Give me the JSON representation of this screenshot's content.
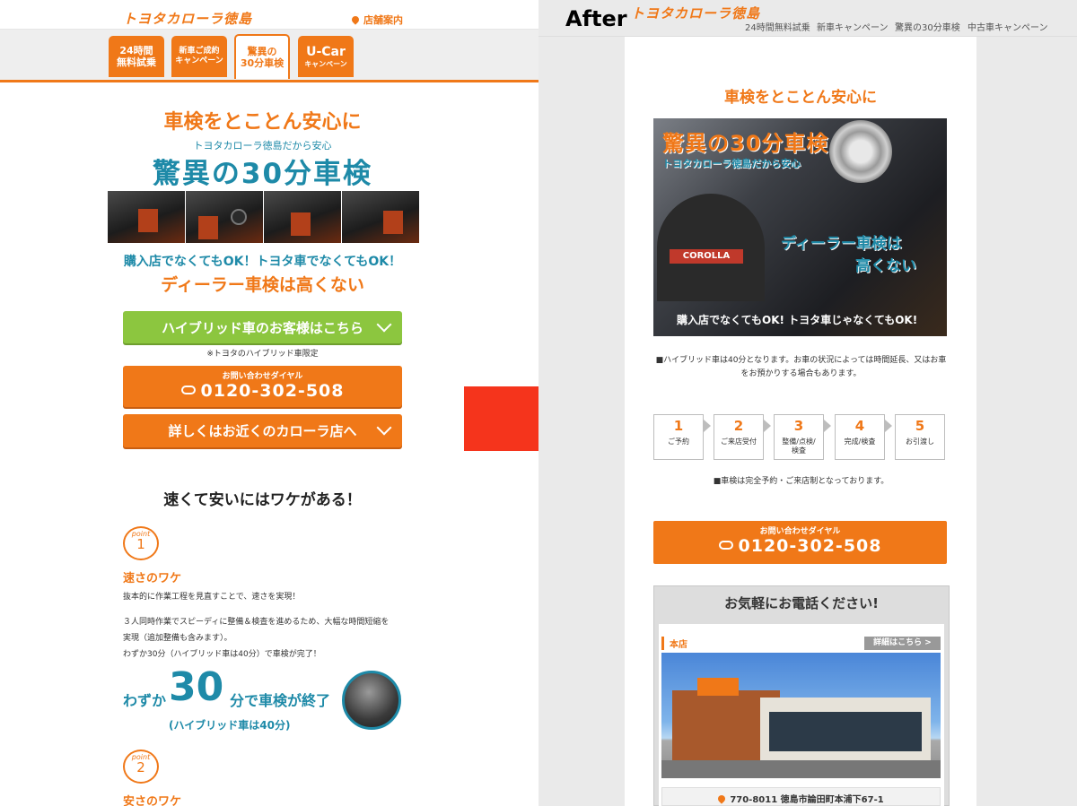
{
  "before": {
    "logo": "トヨタカローラ徳島",
    "store_link": "店舗案内",
    "tabs": [
      {
        "line1": "24時間",
        "line2": "無料試乗"
      },
      {
        "line1": "新車ご成約",
        "line2": "キャンペーン"
      },
      {
        "line1": "驚異の",
        "line2": "30分車検"
      },
      {
        "line1": "U-Car",
        "line2": "キャンペーン"
      }
    ],
    "headline": "車検をとことん安心に",
    "subhead": "トヨタカローラ徳島だから安心",
    "title": "驚異の30分車検",
    "ok_line": "購入店でなくてもOK！トヨタ車でなくてもOK！",
    "dealer_line": "ディーラー車検は高くない",
    "hybrid_button": "ハイブリッド車のお客様はこちら",
    "hybrid_note": "※トヨタのハイブリッド車限定",
    "dial_label": "お問い合わせダイヤル",
    "dial_number": "0120-302-508",
    "nearby_button": "詳しくはお近くのカローラ店へ",
    "why_heading": "速くて安いにはワケがある！",
    "point_word": "point",
    "point1_number": "1",
    "point1_title": "速さのワケ",
    "point1_text1": "抜本的に作業工程を見直すことで、速さを実現！",
    "point1_text2": "３人同時作業でスピーディに整備＆検査を進めるため、大幅な時間短縮を",
    "point1_text3": "実現（追加整備も含みます）。",
    "point1_text4": "わずか30分（ハイブリッド車は40分）で車検が完了！",
    "promo_prefix": "わずか",
    "promo_number": "30",
    "promo_suffix": "分で車検が終了",
    "promo_note": "(ハイブリッド車は40分)",
    "point2_number": "2",
    "point2_title": "安さのワケ"
  },
  "after": {
    "label": "After",
    "logo": "トヨタカローラ徳島",
    "nav": [
      "24時間無料試乗",
      "新車キャンペーン",
      "驚異の30分車検",
      "中古車キャンペーン"
    ],
    "headline": "車検をとことん安心に",
    "banner_title": "驚異の30分車検",
    "banner_sub": "トヨタカローラ徳島だから安心",
    "banner_dealer1": "ディーラー車検は",
    "banner_dealer2": "高くない",
    "banner_ok": "購入店でなくてもOK! トヨタ車じゃなくてもOK!",
    "banner_badge": "COROLLA",
    "note1": "■ハイブリッド車は40分となります。お車の状況によっては時間延長、又はお車をお預かりする場合もあります。",
    "steps": [
      {
        "num": "1",
        "label": "ご予約"
      },
      {
        "num": "2",
        "label": "ご来店受付"
      },
      {
        "num": "3",
        "label": "整備/点検/検査"
      },
      {
        "num": "4",
        "label": "完成/検査"
      },
      {
        "num": "5",
        "label": "お引渡し"
      }
    ],
    "note2": "■車検は完全予約・ご来店制となっております。",
    "dial_label": "お問い合わせダイヤル",
    "dial_number": "0120-302-508",
    "call_title": "お気軽にお電話ください!",
    "branch": "本店",
    "detail_button": "詳細はこちら >",
    "address": "770-8011 徳島市論田町本浦下67-1"
  }
}
